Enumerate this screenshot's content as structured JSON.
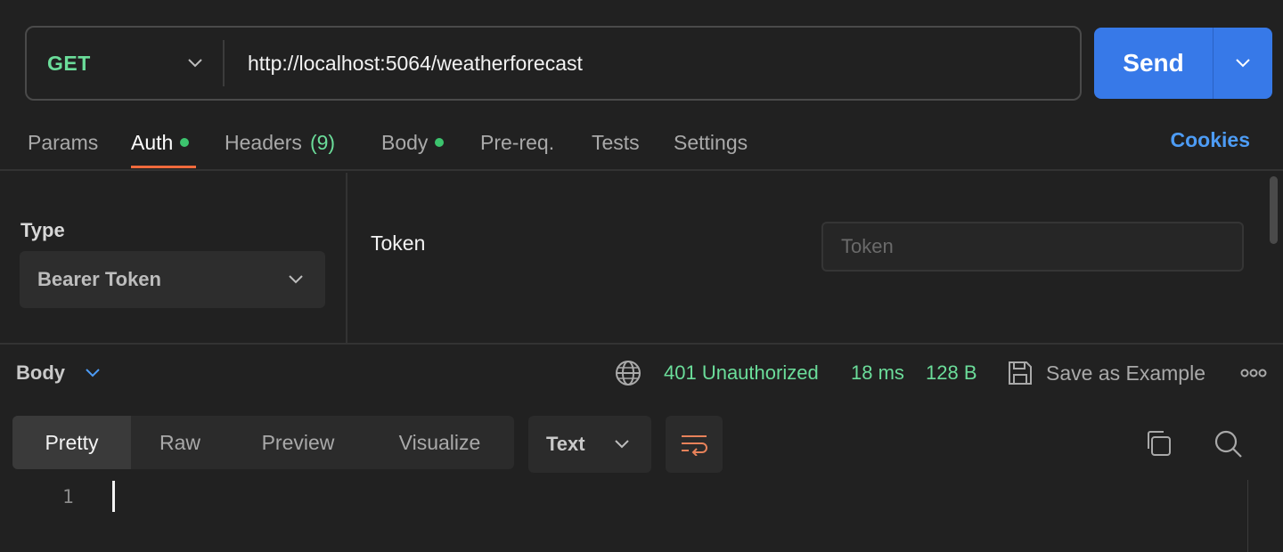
{
  "request": {
    "method": "GET",
    "url": "http://localhost:5064/weatherforecast",
    "send_label": "Send"
  },
  "tabs": [
    {
      "label": "Params"
    },
    {
      "label": "Auth"
    },
    {
      "label": "Headers",
      "count": "(9)"
    },
    {
      "label": "Body"
    },
    {
      "label": "Pre-req."
    },
    {
      "label": "Tests"
    },
    {
      "label": "Settings"
    }
  ],
  "cookies_label": "Cookies",
  "auth": {
    "type_label": "Type",
    "type_value": "Bearer Token",
    "token_label": "Token",
    "token_placeholder": "Token"
  },
  "response": {
    "body_label": "Body",
    "status": "401 Unauthorized",
    "time": "18 ms",
    "size": "128 B",
    "save_label": "Save as Example",
    "view_tabs": [
      "Pretty",
      "Raw",
      "Preview",
      "Visualize"
    ],
    "format": "Text",
    "line_number": "1"
  },
  "colors": {
    "accent_send": "#3779e8",
    "method_green": "#6bdd9a",
    "active_tab_underline": "#f06a3c",
    "cookies_blue": "#4d9cf5"
  },
  "icons": [
    "chevron-down-icon",
    "globe-icon",
    "save-icon",
    "more-icon",
    "wrap-lines-icon",
    "copy-icon",
    "search-icon"
  ]
}
